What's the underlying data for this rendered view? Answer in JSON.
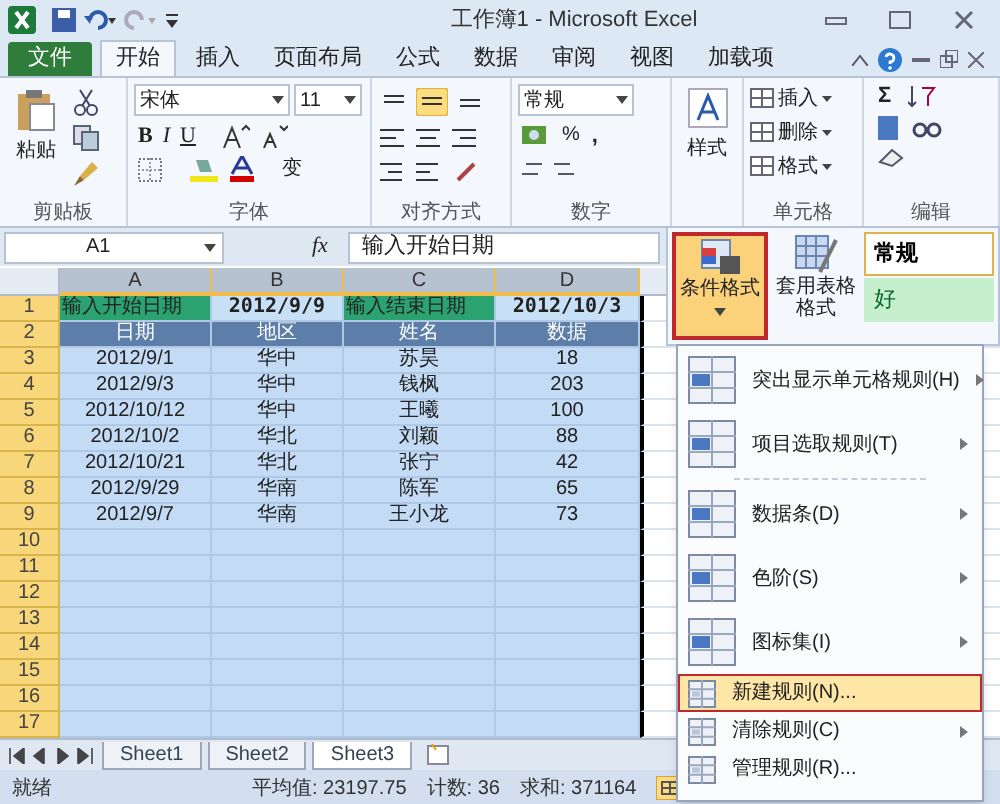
{
  "window": {
    "title": "工作簿1 - Microsoft Excel"
  },
  "tabs": [
    {
      "label": "文件",
      "kind": "file",
      "selected": false
    },
    {
      "label": "开始",
      "kind": "tab",
      "selected": true
    },
    {
      "label": "插入",
      "kind": "tab",
      "selected": false
    },
    {
      "label": "页面布局",
      "kind": "tab",
      "selected": false
    },
    {
      "label": "公式",
      "kind": "tab",
      "selected": false
    },
    {
      "label": "数据",
      "kind": "tab",
      "selected": false
    },
    {
      "label": "审阅",
      "kind": "tab",
      "selected": false
    },
    {
      "label": "视图",
      "kind": "tab",
      "selected": false
    },
    {
      "label": "加载项",
      "kind": "tab",
      "selected": false
    }
  ],
  "ribbon": {
    "clipboard": {
      "paste": "粘贴",
      "label": "剪贴板"
    },
    "font": {
      "font_name": "宋体",
      "font_size": "11",
      "bold": "B",
      "italic": "I",
      "underline": "U",
      "phonetic": "变",
      "label": "字体"
    },
    "alignment": {
      "buttons": [
        {
          "selected": false
        },
        {
          "selected": true
        },
        {
          "selected": false
        }
      ],
      "label": "对齐方式"
    },
    "number": {
      "format": "常规",
      "percent": "%",
      "comma": ",",
      "label": "数字"
    },
    "styles": {
      "button": "样式"
    },
    "cells": {
      "items": [
        "插入",
        "删除",
        "格式"
      ],
      "label": "单元格"
    },
    "editing": {
      "sum": "Σ",
      "label": "编辑"
    }
  },
  "formula_bar": {
    "name_box": "A1",
    "function_label": "fx",
    "value": "输入开始日期"
  },
  "sheet": {
    "columns": [
      {
        "label": "A",
        "selected": true
      },
      {
        "label": "B",
        "selected": true
      },
      {
        "label": "C",
        "selected": true
      },
      {
        "label": "D",
        "selected": true
      }
    ],
    "rows": [
      {
        "number": "1",
        "kind": "input",
        "cells": [
          "输入开始日期",
          "2012/9/9",
          "输入结束日期",
          "2012/10/3"
        ]
      },
      {
        "number": "2",
        "kind": "header",
        "cells": [
          "日期",
          "地区",
          "姓名",
          "数据"
        ]
      },
      {
        "number": "3",
        "kind": "data",
        "cells": [
          "2012/9/1",
          "华中",
          "苏昊",
          "18"
        ]
      },
      {
        "number": "4",
        "kind": "data",
        "cells": [
          "2012/9/3",
          "华中",
          "钱枫",
          "203"
        ]
      },
      {
        "number": "5",
        "kind": "data",
        "cells": [
          "2012/10/12",
          "华中",
          "王曦",
          "100"
        ]
      },
      {
        "number": "6",
        "kind": "data",
        "cells": [
          "2012/10/2",
          "华北",
          "刘颖",
          "88"
        ]
      },
      {
        "number": "7",
        "kind": "data",
        "cells": [
          "2012/10/21",
          "华北",
          "张宁",
          "42"
        ]
      },
      {
        "number": "8",
        "kind": "data",
        "cells": [
          "2012/9/29",
          "华南",
          "陈军",
          "65"
        ]
      },
      {
        "number": "9",
        "kind": "data",
        "cells": [
          "2012/9/7",
          "华南",
          "王小龙",
          "73"
        ]
      },
      {
        "number": "10",
        "kind": "data",
        "cells": []
      },
      {
        "number": "11",
        "kind": "data",
        "cells": []
      },
      {
        "number": "12",
        "kind": "data",
        "cells": []
      },
      {
        "number": "13",
        "kind": "data",
        "cells": []
      },
      {
        "number": "14",
        "kind": "data",
        "cells": []
      },
      {
        "number": "15",
        "kind": "data",
        "cells": []
      },
      {
        "number": "16",
        "kind": "data",
        "cells": []
      },
      {
        "number": "17",
        "kind": "data",
        "cells": []
      }
    ]
  },
  "sheet_tabs": [
    {
      "label": "Sheet1",
      "selected": false
    },
    {
      "label": "Sheet2",
      "selected": false
    },
    {
      "label": "Sheet3",
      "selected": true
    }
  ],
  "status_bar": {
    "state": "就绪",
    "average": "平均值: 23197.75",
    "count": "计数: 36",
    "sum": "求和: 371164"
  },
  "styles_popup": {
    "conditional_format": {
      "label": "条件格式",
      "selected": true
    },
    "format_as_table": "套用表格格式",
    "cell_styles": [
      {
        "label": "常规",
        "kind": "normal"
      },
      {
        "label": "好",
        "kind": "good"
      }
    ]
  },
  "menu": [
    {
      "label": "突出显示单元格规则(H)",
      "kind": "large",
      "submenu": true,
      "selected": false
    },
    {
      "label": "项目选取规则(T)",
      "kind": "large",
      "submenu": true,
      "selected": false
    },
    {
      "kind": "separator"
    },
    {
      "label": "数据条(D)",
      "kind": "large",
      "submenu": true,
      "selected": false
    },
    {
      "label": "色阶(S)",
      "kind": "large",
      "submenu": true,
      "selected": false
    },
    {
      "label": "图标集(I)",
      "kind": "large",
      "submenu": true,
      "selected": false
    },
    {
      "label": "新建规则(N)...",
      "kind": "small",
      "submenu": false,
      "selected": true
    },
    {
      "label": "清除规则(C)",
      "kind": "small",
      "submenu": true,
      "selected": false
    },
    {
      "label": "管理规则(R)...",
      "kind": "small",
      "submenu": false,
      "selected": false
    }
  ]
}
